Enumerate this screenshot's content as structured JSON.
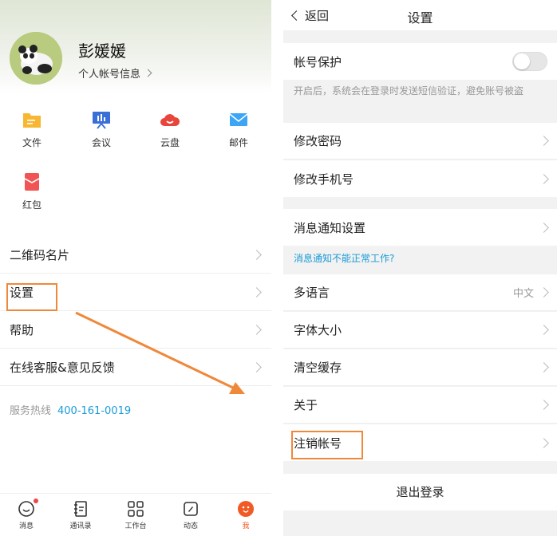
{
  "left": {
    "user_name": "彭媛媛",
    "account_link": "个人帐号信息",
    "apps": [
      {
        "label": "文件",
        "icon": "folder-icon",
        "color": "#f7b733"
      },
      {
        "label": "会议",
        "icon": "meeting-icon",
        "color": "#3a6fd8"
      },
      {
        "label": "云盘",
        "icon": "cloud-icon",
        "color": "#e8453c"
      },
      {
        "label": "邮件",
        "icon": "mail-icon",
        "color": "#3da5f5"
      },
      {
        "label": "红包",
        "icon": "red-envelope-icon",
        "color": "#f05454"
      }
    ],
    "menu": [
      {
        "label": "二维码名片"
      },
      {
        "label": "设置"
      },
      {
        "label": "帮助"
      },
      {
        "label": "在线客服&意见反馈"
      }
    ],
    "hotline_label": "服务热线",
    "hotline_number": "400-161-0019",
    "tabs": [
      {
        "label": "消息",
        "icon": "message-icon"
      },
      {
        "label": "通讯录",
        "icon": "contacts-icon"
      },
      {
        "label": "工作台",
        "icon": "workbench-icon"
      },
      {
        "label": "动态",
        "icon": "moments-icon"
      },
      {
        "label": "我",
        "icon": "me-icon",
        "active": true
      }
    ]
  },
  "right": {
    "back_label": "返回",
    "title": "设置",
    "account_protection": "帐号保护",
    "account_protection_on": false,
    "protection_hint": "开启后，系统会在登录时发送短信验证，避免账号被盗",
    "change_password": "修改密码",
    "change_phone": "修改手机号",
    "notification_settings": "消息通知设置",
    "notification_help": "消息通知不能正常工作?",
    "language": "多语言",
    "language_value": "中文",
    "font_size": "字体大小",
    "clear_cache": "清空缓存",
    "about": "关于",
    "delete_account": "注销帐号",
    "logout": "退出登录"
  },
  "colors": {
    "accent_link": "#1a9bd7",
    "highlight": "#f0883a",
    "active_tab": "#f15a24"
  }
}
